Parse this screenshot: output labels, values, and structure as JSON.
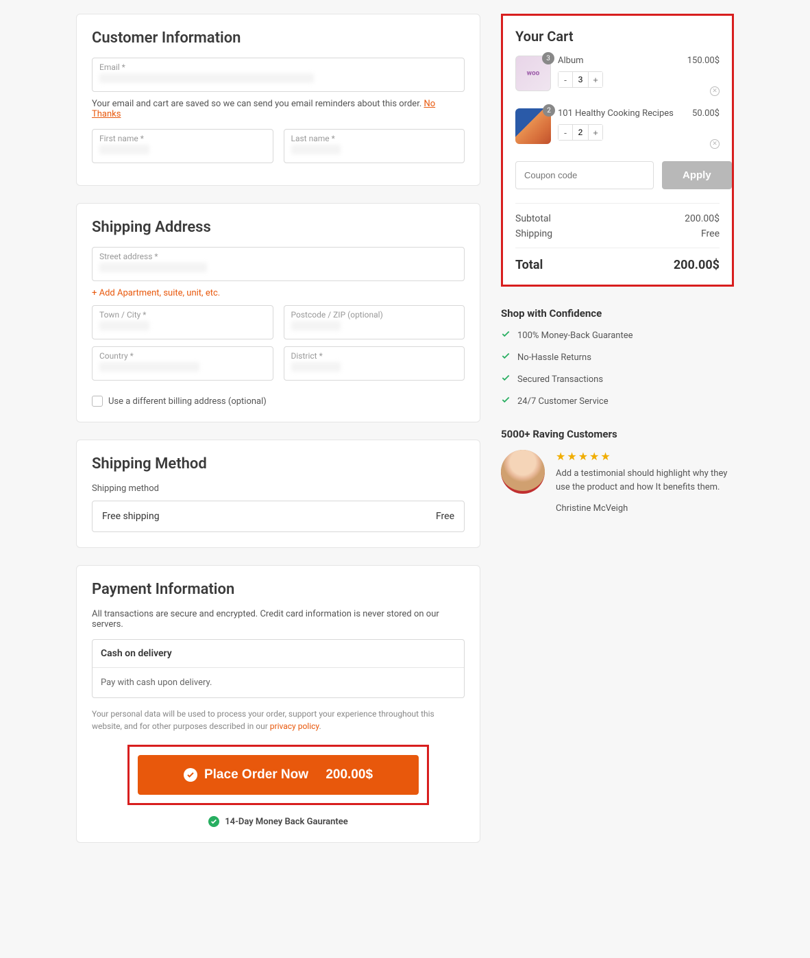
{
  "customer": {
    "title": "Customer Information",
    "email_label": "Email *",
    "first_label": "First name *",
    "last_label": "Last name *",
    "saved_hint": "Your email and cart are saved so we can send you email reminders about this order. ",
    "no_thanks": "No Thanks"
  },
  "shipping": {
    "title": "Shipping Address",
    "street_label": "Street address *",
    "add_apt": "Add Apartment, suite, unit, etc.",
    "town_label": "Town / City *",
    "postcode_label": "Postcode / ZIP (optional)",
    "country_label": "Country *",
    "district_label": "District *",
    "diff_billing": "Use a different billing address (optional)"
  },
  "method": {
    "title": "Shipping Method",
    "label": "Shipping method",
    "option_name": "Free shipping",
    "option_cost": "Free"
  },
  "payment": {
    "title": "Payment Information",
    "secure": "All transactions are secure and encrypted. Credit card information is never stored on our servers.",
    "method_name": "Cash on delivery",
    "method_desc": "Pay with cash upon delivery.",
    "privacy_pre": "Your personal data will be used to process your order, support your experience throughout this website, and for other purposes described in our ",
    "privacy_link": "privacy policy",
    "privacy_post": ".",
    "place_order_label": "Place Order Now",
    "place_order_amount": "200.00$",
    "guarantee": "14-Day Money Back Gaurantee"
  },
  "cart": {
    "title": "Your Cart",
    "items": [
      {
        "name": "Album",
        "price": "150.00$",
        "qty": "3",
        "badge": "3"
      },
      {
        "name": "101 Healthy Cooking Recipes",
        "price": "50.00$",
        "qty": "2",
        "badge": "2"
      }
    ],
    "coupon_placeholder": "Coupon code",
    "apply_label": "Apply",
    "subtotal_label": "Subtotal",
    "subtotal_val": "200.00$",
    "shipping_label": "Shipping",
    "shipping_val": "Free",
    "total_label": "Total",
    "total_val": "200.00$"
  },
  "confidence": {
    "title": "Shop with Confidence",
    "items": [
      "100% Money-Back Guarantee",
      "No-Hassle Returns",
      "Secured Transactions",
      "24/7 Customer Service"
    ]
  },
  "testimonials": {
    "title": "5000+ Raving Customers",
    "text": "Add a testimonial should highlight why they use the product and how It benefits them.",
    "author": "Christine McVeigh"
  }
}
